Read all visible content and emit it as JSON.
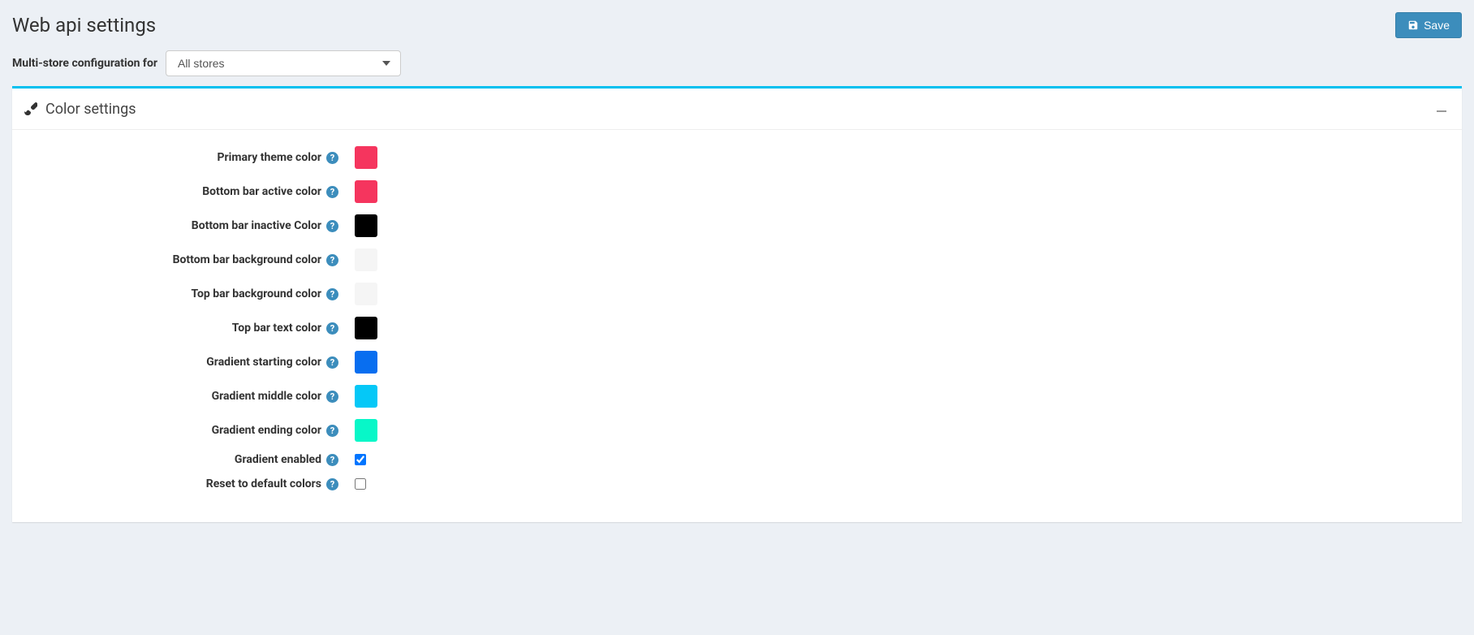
{
  "header": {
    "title": "Web api settings",
    "saveLabel": "Save"
  },
  "multiStore": {
    "label": "Multi-store configuration for",
    "selected": "All stores"
  },
  "panel": {
    "title": "Color settings"
  },
  "fields": {
    "primaryThemeColor": {
      "label": "Primary theme color",
      "value": "#f5355e"
    },
    "bottomBarActiveColor": {
      "label": "Bottom bar active color",
      "value": "#f5355e"
    },
    "bottomBarInactiveColor": {
      "label": "Bottom bar inactive Color",
      "value": "#000000"
    },
    "bottomBarBackgroundColor": {
      "label": "Bottom bar background color",
      "value": "#f5f5f5"
    },
    "topBarBackgroundColor": {
      "label": "Top bar background color",
      "value": "#f5f5f5"
    },
    "topBarTextColor": {
      "label": "Top bar text color",
      "value": "#000000"
    },
    "gradientStartingColor": {
      "label": "Gradient starting color",
      "value": "#086ef0"
    },
    "gradientMiddleColor": {
      "label": "Gradient middle color",
      "value": "#05c8f7"
    },
    "gradientEndingColor": {
      "label": "Gradient ending color",
      "value": "#08f7c8"
    },
    "gradientEnabled": {
      "label": "Gradient enabled",
      "checked": true
    },
    "resetToDefaultColors": {
      "label": "Reset to default colors",
      "checked": false
    }
  }
}
